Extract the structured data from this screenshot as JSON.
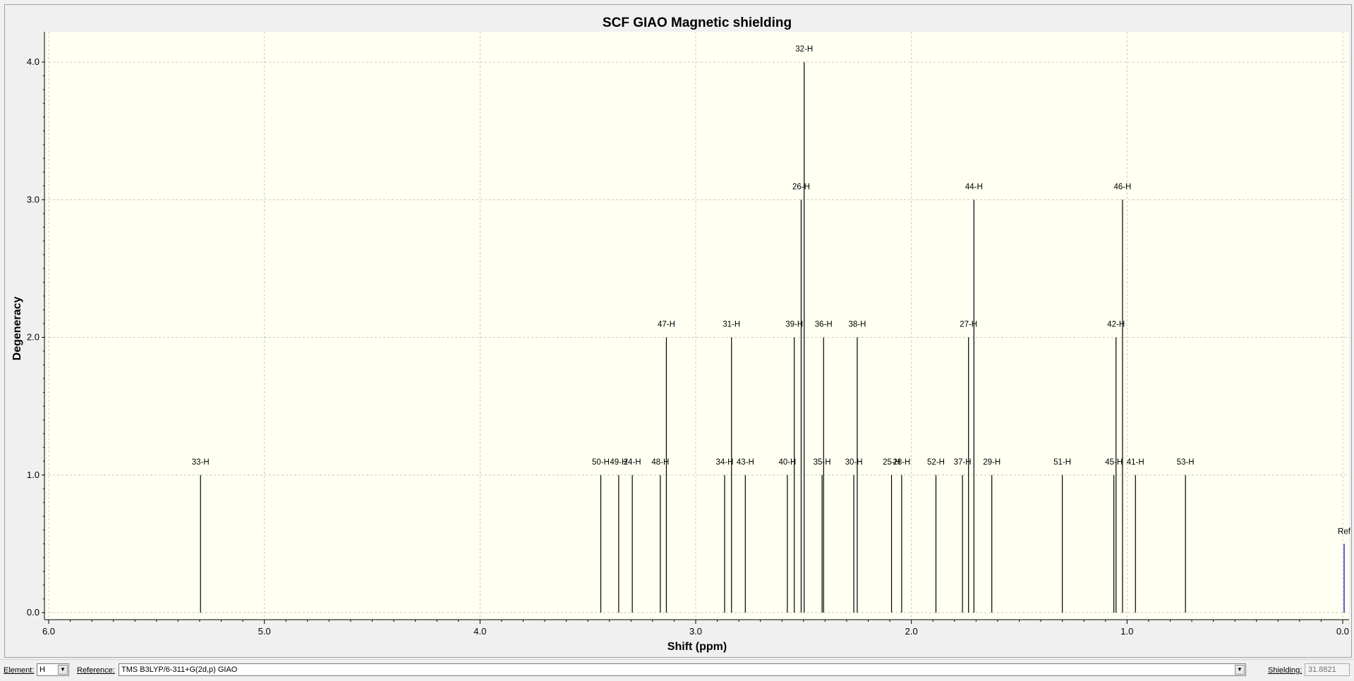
{
  "chart_data": {
    "type": "bar",
    "title": "SCF GIAO Magnetic shielding",
    "xlabel": "Shift (ppm)",
    "ylabel": "Degeneracy",
    "xlim": [
      6.0,
      0.0
    ],
    "ylim": [
      0.0,
      4.2
    ],
    "x_reversed": true,
    "grid": true,
    "x_ticks": [
      "6.0",
      "5.0",
      "4.0",
      "3.0",
      "2.0",
      "1.0",
      "0.0"
    ],
    "y_ticks": [
      "0.0",
      "1.0",
      "2.0",
      "3.0",
      "4.0"
    ],
    "peaks": [
      {
        "label": "33-H",
        "shift": 5.296,
        "degeneracy": 1
      },
      {
        "label": "50-H",
        "shift": 3.44,
        "degeneracy": 1
      },
      {
        "label": "49-H",
        "shift": 3.357,
        "degeneracy": 1
      },
      {
        "label": "24-H",
        "shift": 3.294,
        "degeneracy": 1
      },
      {
        "label": "48-H",
        "shift": 3.164,
        "degeneracy": 1
      },
      {
        "label": "47-H",
        "shift": 3.136,
        "degeneracy": 2
      },
      {
        "label": "34-H",
        "shift": 2.866,
        "degeneracy": 1
      },
      {
        "label": "31-H",
        "shift": 2.834,
        "degeneracy": 2
      },
      {
        "label": "43-H",
        "shift": 2.77,
        "degeneracy": 1
      },
      {
        "label": "40-H",
        "shift": 2.575,
        "degeneracy": 1
      },
      {
        "label": "39-H",
        "shift": 2.543,
        "degeneracy": 2
      },
      {
        "label": "26-H",
        "shift": 2.511,
        "degeneracy": 3
      },
      {
        "label": "32-H",
        "shift": 2.497,
        "degeneracy": 4
      },
      {
        "label": "35-H",
        "shift": 2.414,
        "degeneracy": 1
      },
      {
        "label": "36-H",
        "shift": 2.407,
        "degeneracy": 2
      },
      {
        "label": "30-H",
        "shift": 2.267,
        "degeneracy": 1
      },
      {
        "label": "38-H",
        "shift": 2.251,
        "degeneracy": 2
      },
      {
        "label": "25-H",
        "shift": 2.092,
        "degeneracy": 1
      },
      {
        "label": "28-H",
        "shift": 2.045,
        "degeneracy": 1
      },
      {
        "label": "52-H",
        "shift": 1.886,
        "degeneracy": 1
      },
      {
        "label": "37-H",
        "shift": 1.763,
        "degeneracy": 1
      },
      {
        "label": "27-H",
        "shift": 1.735,
        "degeneracy": 2
      },
      {
        "label": "44-H",
        "shift": 1.71,
        "degeneracy": 3
      },
      {
        "label": "29-H",
        "shift": 1.627,
        "degeneracy": 1
      },
      {
        "label": "51-H",
        "shift": 1.3,
        "degeneracy": 1
      },
      {
        "label": "45-H",
        "shift": 1.061,
        "degeneracy": 1
      },
      {
        "label": "42-H",
        "shift": 1.051,
        "degeneracy": 2
      },
      {
        "label": "46-H",
        "shift": 1.021,
        "degeneracy": 3
      },
      {
        "label": "41-H",
        "shift": 0.961,
        "degeneracy": 1
      },
      {
        "label": "53-H",
        "shift": 0.729,
        "degeneracy": 1
      }
    ],
    "reference_marker": {
      "label": "Ref",
      "shift": 0.0,
      "degeneracy": 0.5
    }
  },
  "colors": {
    "plot_background": "#fffff2",
    "grid": "#c8c8c8",
    "peak": "#000000",
    "reference": "#2020c0"
  },
  "bottom_bar": {
    "element_label": "Element:",
    "element_value": "H",
    "reference_label": "Reference:",
    "reference_value": "TMS B3LYP/6-311+G(2d,p) GIAO",
    "shielding_label": "Shielding:",
    "shielding_value": "31.8821",
    "dropdown_icon": "chevron-down-icon"
  }
}
